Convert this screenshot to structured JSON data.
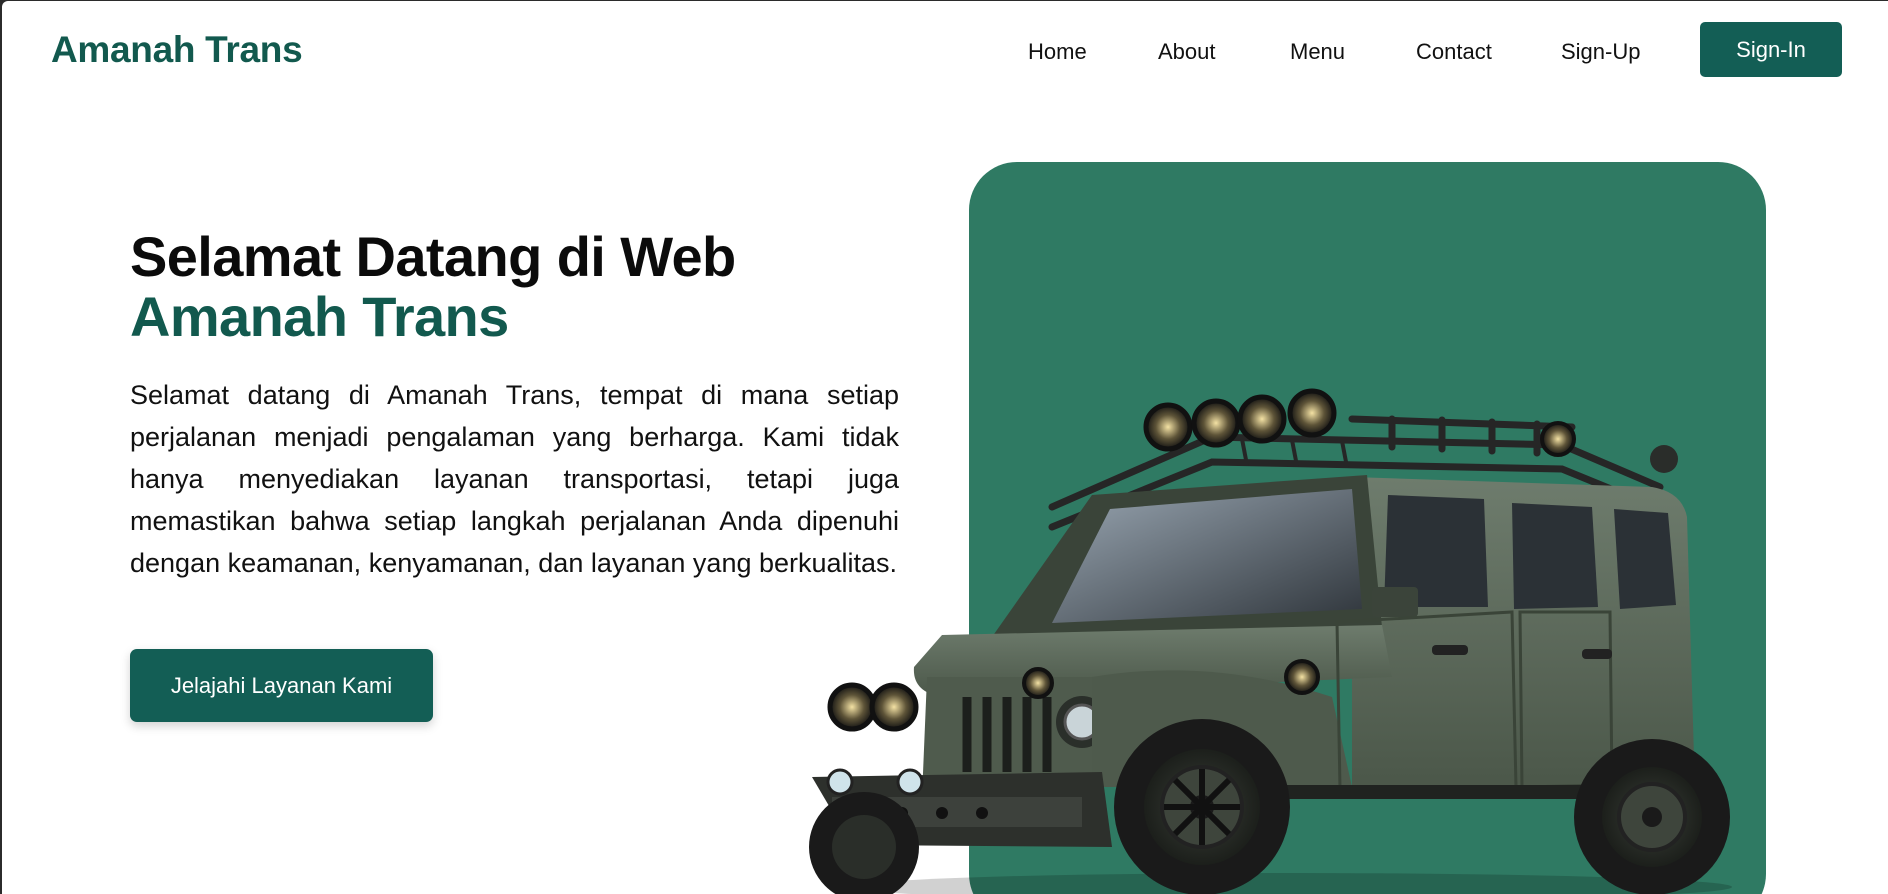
{
  "header": {
    "brand": "Amanah Trans",
    "nav": [
      "Home",
      "About",
      "Menu",
      "Contact",
      "Sign-Up"
    ],
    "signin_label": "Sign-In"
  },
  "hero": {
    "title_line1": "Selamat Datang di Web",
    "title_line2": "Amanah Trans",
    "description": "Selamat datang di Amanah Trans, tempat di mana setiap perjalanan menjadi pengalaman yang berharga. Kami tidak hanya menyediakan layanan transportasi, tetapi juga memastikan bahwa setiap langkah perjalanan Anda dipenuhi dengan keamanan, kenyamanan, dan layanan yang berkualitas.",
    "cta_label": "Jelajahi Layanan Kami"
  },
  "colors": {
    "brand": "#12594e",
    "button": "#135e55",
    "hero_card": "#2f7a63",
    "vehicle_body": "#5c6a5c"
  },
  "image": {
    "subject": "jeep-illustration"
  }
}
